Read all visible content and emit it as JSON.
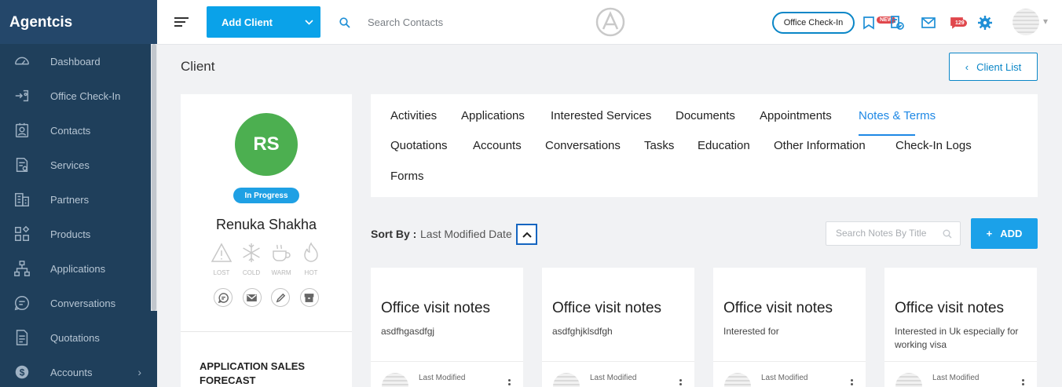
{
  "app": {
    "brand": "Agentcis"
  },
  "sidebar": {
    "items": [
      {
        "label": "Dashboard",
        "icon": "dashboard-icon"
      },
      {
        "label": "Office Check-In",
        "icon": "office-checkin-icon"
      },
      {
        "label": "Contacts",
        "icon": "contacts-icon"
      },
      {
        "label": "Services",
        "icon": "services-icon"
      },
      {
        "label": "Partners",
        "icon": "partners-icon"
      },
      {
        "label": "Products",
        "icon": "products-icon"
      },
      {
        "label": "Applications",
        "icon": "applications-icon"
      },
      {
        "label": "Conversations",
        "icon": "conversations-icon"
      },
      {
        "label": "Quotations",
        "icon": "quotations-icon"
      },
      {
        "label": "Accounts",
        "icon": "accounts-icon",
        "chevron": "›"
      }
    ]
  },
  "topbar": {
    "add_client_label": "Add Client",
    "search_placeholder": "Search Contacts",
    "office_checkin_label": "Office Check-In",
    "new_badge": "NEW",
    "notification_count": "129"
  },
  "page": {
    "title": "Client",
    "client_list_label": "Client List",
    "client_list_chevron": "‹"
  },
  "client": {
    "initials": "RS",
    "status": "In Progress",
    "name": "Renuka Shakha",
    "temperatures": [
      "LOST",
      "COLD",
      "WARM",
      "HOT"
    ],
    "forecast_heading": "APPLICATION SALES FORECAST"
  },
  "tabs": {
    "row1": [
      "Activities",
      "Applications",
      "Interested Services",
      "Documents",
      "Appointments",
      "Notes & Terms"
    ],
    "row2": [
      "Quotations",
      "Accounts",
      "Conversations",
      "Tasks",
      "Education",
      "Other Information",
      "Check-In Logs"
    ],
    "row3": [
      "Forms"
    ],
    "active": "Notes & Terms"
  },
  "notes_toolbar": {
    "sort_label": "Sort By :",
    "sort_value": "Last Modified Date",
    "search_placeholder": "Search Notes By Title",
    "add_label": "ADD",
    "add_prefix": "+"
  },
  "notes": [
    {
      "title": "Office visit notes",
      "body": "asdfhgasdfgj",
      "footer_label": "Last Modified"
    },
    {
      "title": "Office visit notes",
      "body": "asdfghjklsdfgh",
      "footer_label": "Last Modified"
    },
    {
      "title": "Office visit notes",
      "body": "Interested for",
      "footer_label": "Last Modified"
    },
    {
      "title": "Office visit notes",
      "body": "Interested in Uk especially for working visa",
      "footer_label": "Last Modified"
    }
  ],
  "colors": {
    "sidebar_bg": "#1f3f5b",
    "accent": "#0aa2e9",
    "active_tab": "#1e88e5",
    "avatar_green": "#4caf50",
    "badge_red": "#e0474c"
  }
}
